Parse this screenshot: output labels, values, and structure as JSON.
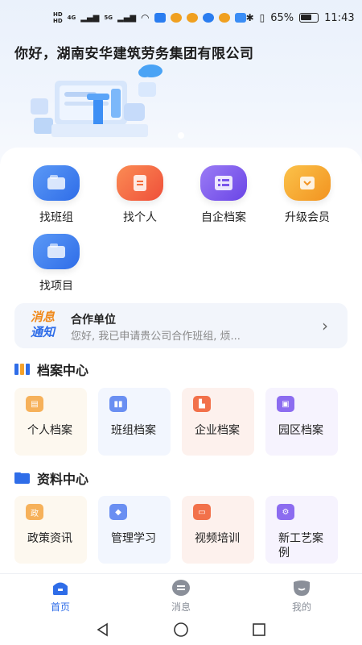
{
  "status_bar": {
    "net1": "HD",
    "net2": "HD",
    "sig1": "4G",
    "sig2": "5G",
    "battery_pct": "65%",
    "time": "11:43"
  },
  "header": {
    "greeting": "你好，湖南安华建筑劳务集团有限公司"
  },
  "quick_grid": [
    {
      "label": "找班组",
      "icon": "team-icon",
      "color": "#3d7ef0"
    },
    {
      "label": "找个人",
      "icon": "person-icon",
      "color": "#f36b3b"
    },
    {
      "label": "自企档案",
      "icon": "archive-icon",
      "color": "#7a55ea"
    },
    {
      "label": "升级会员",
      "icon": "vip-icon",
      "color": "#f6a22a"
    },
    {
      "label": "找项目",
      "icon": "project-icon",
      "color": "#3d7ef0"
    }
  ],
  "notice": {
    "tag_a": "消息",
    "tag_b": "通知",
    "title": "合作单位",
    "body": "您好, 我已申请贵公司合作班组, 烦...",
    "arrow": "›"
  },
  "archive_center": {
    "title": "档案中心",
    "items": [
      {
        "label": "个人档案",
        "icon": "document-icon",
        "color": "#f6b15a",
        "bg": "#fdf8ef"
      },
      {
        "label": "班组档案",
        "icon": "group-icon",
        "color": "#6a8ff2",
        "bg": "#f2f6fe"
      },
      {
        "label": "企业档案",
        "icon": "company-icon",
        "color": "#f2714a",
        "bg": "#fdf1ed"
      },
      {
        "label": "园区档案",
        "icon": "park-icon",
        "color": "#8c6cf0",
        "bg": "#f6f3fe"
      }
    ]
  },
  "resource_center": {
    "title": "资料中心",
    "items": [
      {
        "label": "政策资讯",
        "icon_text": "政",
        "icon": "policy-icon",
        "color": "#f6b15a",
        "bg": "#fdf8ef"
      },
      {
        "label": "管理学习",
        "icon_text": "",
        "icon": "study-icon",
        "color": "#6a8ff2",
        "bg": "#f2f6fe"
      },
      {
        "label": "视频培训",
        "icon_text": "",
        "icon": "video-icon",
        "color": "#f2714a",
        "bg": "#fdf1ed"
      },
      {
        "label": "新工艺案例",
        "icon_text": "",
        "icon": "gear-icon",
        "color": "#8c6cf0",
        "bg": "#f6f3fe"
      }
    ]
  },
  "bottom_nav": [
    {
      "label": "首页",
      "active": true
    },
    {
      "label": "消息",
      "active": false
    },
    {
      "label": "我的",
      "active": false
    }
  ],
  "colors": {
    "accent": "#2f6de8",
    "inactive": "#8a8f99"
  }
}
